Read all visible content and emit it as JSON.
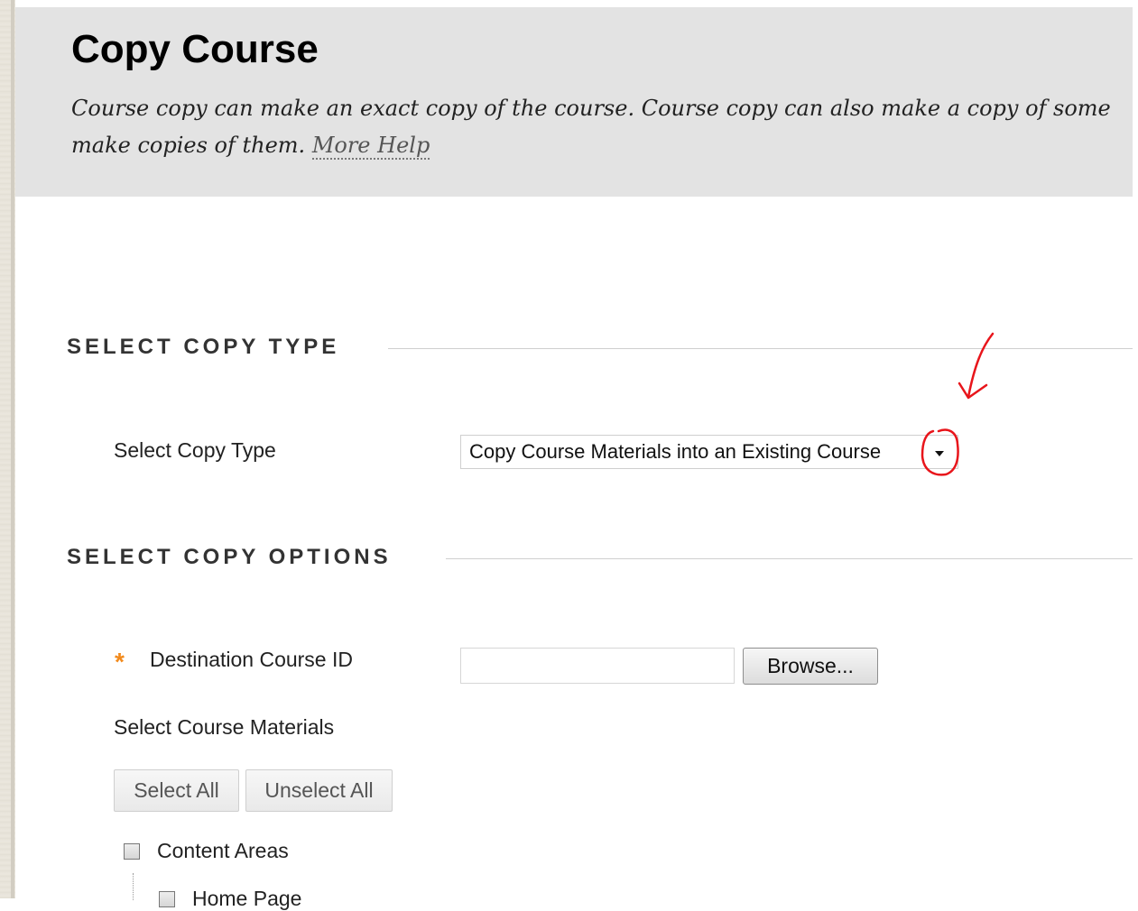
{
  "header": {
    "title": "Copy Course",
    "description": "Course copy can make an exact copy of the course. Course copy can also make a copy of some",
    "description_line2": "make copies of them.",
    "more_help_link": "More Help"
  },
  "sections": {
    "copy_type": {
      "heading": "SELECT COPY TYPE",
      "field_label": "Select Copy Type",
      "selected_value": "Copy Course Materials into an Existing Course"
    },
    "copy_options": {
      "heading": "SELECT COPY OPTIONS",
      "destination_label": "Destination Course ID",
      "required_marker": "*",
      "destination_value": "",
      "browse_button": "Browse...",
      "materials_label": "Select Course Materials",
      "select_all_button": "Select All",
      "unselect_all_button": "Unselect All",
      "tree": [
        {
          "label": "Content Areas",
          "checked": false
        },
        {
          "label": "Home Page",
          "checked": false
        }
      ]
    }
  },
  "annotation": {
    "color": "#e8151b",
    "arrow-icon": "hand-drawn-arrow-icon",
    "circle-icon": "hand-drawn-circle-icon"
  }
}
